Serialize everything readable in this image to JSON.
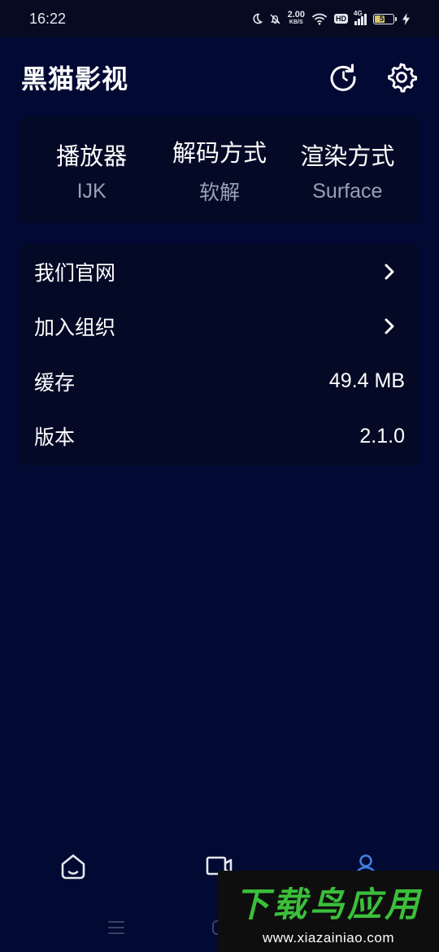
{
  "status_bar": {
    "time": "16:22",
    "net_speed_value": "2.00",
    "net_speed_unit": "KB/S",
    "hd_badge": "HD",
    "network_type": "4G",
    "battery_level": "57",
    "icons": [
      "moon-icon",
      "bell-off-icon",
      "wifi-icon",
      "signal-icon",
      "battery-icon",
      "charging-icon"
    ]
  },
  "header": {
    "title": "黑猫影视",
    "actions": [
      "refresh-icon",
      "gear-icon"
    ]
  },
  "player_settings": [
    {
      "label": "播放器",
      "value": "IJK"
    },
    {
      "label": "解码方式",
      "value": "软解"
    },
    {
      "label": "渲染方式",
      "value": "Surface"
    }
  ],
  "info_list": [
    {
      "label": "我们官网",
      "value": null,
      "chevron": true
    },
    {
      "label": "加入组织",
      "value": null,
      "chevron": true
    },
    {
      "label": "缓存",
      "value": "49.4 MB",
      "chevron": false
    },
    {
      "label": "版本",
      "value": "2.1.0",
      "chevron": false
    }
  ],
  "bottom_nav": {
    "items": [
      "home-icon",
      "video-icon",
      "profile-icon"
    ],
    "active": "profile-icon"
  },
  "watermark": {
    "logo_text": "下载鸟应用",
    "url": "www.xiazainiao.com"
  },
  "colors": {
    "background": "#020a33",
    "card": "#040a26",
    "secondary_text": "#9aa0b6",
    "active_nav": "#3f7fe0",
    "watermark_green": "#3bbf3b"
  }
}
